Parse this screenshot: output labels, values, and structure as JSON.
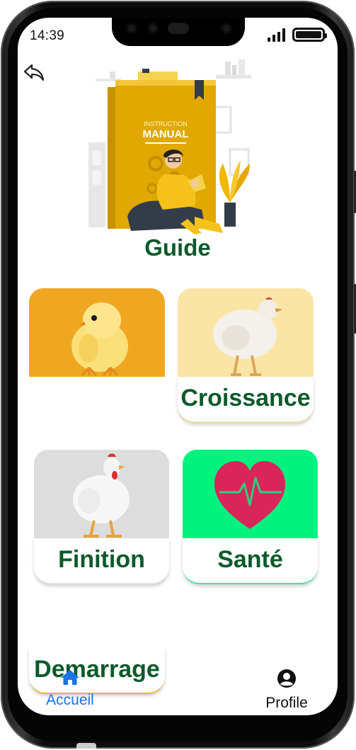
{
  "status_bar": {
    "time": "14:39"
  },
  "page": {
    "title": "Guide"
  },
  "hero": {
    "book_text_top": "INSTRUCTION",
    "book_text_main": "MANUAL"
  },
  "cards": [
    {
      "label": "Demarrage",
      "color": "#efa721"
    },
    {
      "label": "Croissance",
      "color": "#fbe5a6"
    },
    {
      "label": "Finition",
      "color": "#dddddd"
    },
    {
      "label": "Santé",
      "color": "#00f27f"
    }
  ],
  "nav": {
    "home": {
      "label": "Accueil",
      "icon": "home-icon",
      "active": true
    },
    "profile": {
      "label": "Profile",
      "icon": "user-circle-icon"
    }
  },
  "colors": {
    "title_green": "#0b5a2a",
    "active_blue": "#1a73e8"
  }
}
